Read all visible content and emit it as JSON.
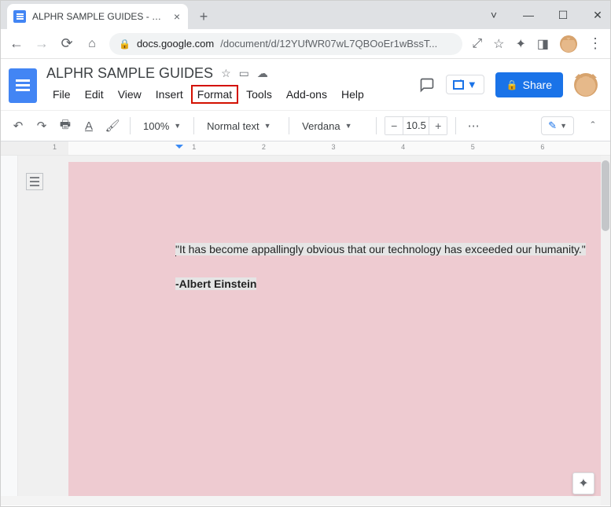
{
  "browser": {
    "tab_title": "ALPHR SAMPLE GUIDES - Google",
    "url_domain": "docs.google.com",
    "url_path": "/document/d/12YUfWR07wL7QBOoEr1wBssT..."
  },
  "docs": {
    "title": "ALPHR SAMPLE GUIDES",
    "menus": [
      "File",
      "Edit",
      "View",
      "Insert",
      "Format",
      "Tools",
      "Add-ons",
      "Help"
    ],
    "highlighted_menu": "Format",
    "share_label": "Share"
  },
  "toolbar": {
    "zoom": "100%",
    "style": "Normal text",
    "font": "Verdana",
    "font_size": "10.5"
  },
  "ruler": {
    "numbers": [
      "1",
      "",
      "1",
      "2",
      "3",
      "4",
      "5",
      "6"
    ]
  },
  "document": {
    "quote": "\"It has become appallingly obvious that our technology has exceeded our humanity.\"",
    "author": "-Albert Einstein"
  }
}
